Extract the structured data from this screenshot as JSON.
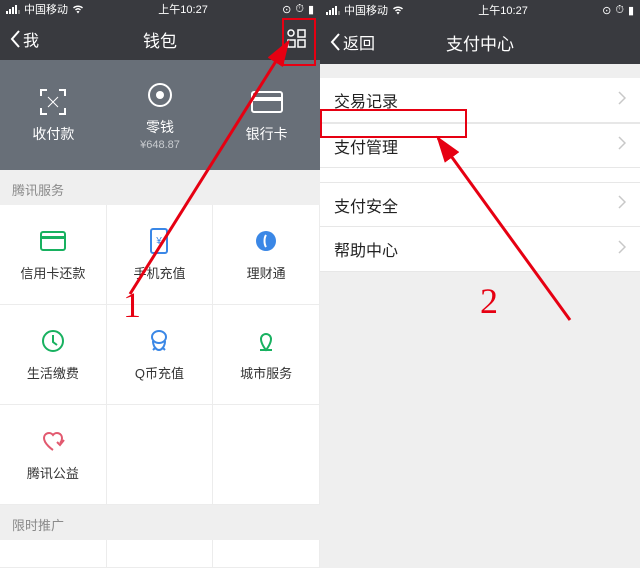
{
  "status": {
    "carrier": "中国移动",
    "time": "上午10:27"
  },
  "left": {
    "nav": {
      "back": "我",
      "title": "钱包"
    },
    "top": {
      "pay": "收付款",
      "balance": "零钱",
      "balance_amount": "¥648.87",
      "bank": "银行卡"
    },
    "sect1": "腾讯服务",
    "grid": [
      {
        "k": "credit",
        "label": "信用卡还款",
        "color": "#18b160"
      },
      {
        "k": "recharge",
        "label": "手机充值",
        "color": "#3a87e6"
      },
      {
        "k": "licaitong",
        "label": "理财通",
        "color": "#3a87e6"
      },
      {
        "k": "life",
        "label": "生活缴费",
        "color": "#18b160"
      },
      {
        "k": "qcoin",
        "label": "Q币充值",
        "color": "#3a87e6"
      },
      {
        "k": "city",
        "label": "城市服务",
        "color": "#18b160"
      },
      {
        "k": "charity",
        "label": "腾讯公益",
        "color": "#e2596f"
      }
    ],
    "sect2": "限时推广"
  },
  "right": {
    "nav": {
      "back": "返回",
      "title": "支付中心"
    },
    "menu": [
      "交易记录",
      "支付管理",
      "支付安全",
      "帮助中心"
    ]
  },
  "anno": {
    "n1": "1",
    "n2": "2"
  }
}
